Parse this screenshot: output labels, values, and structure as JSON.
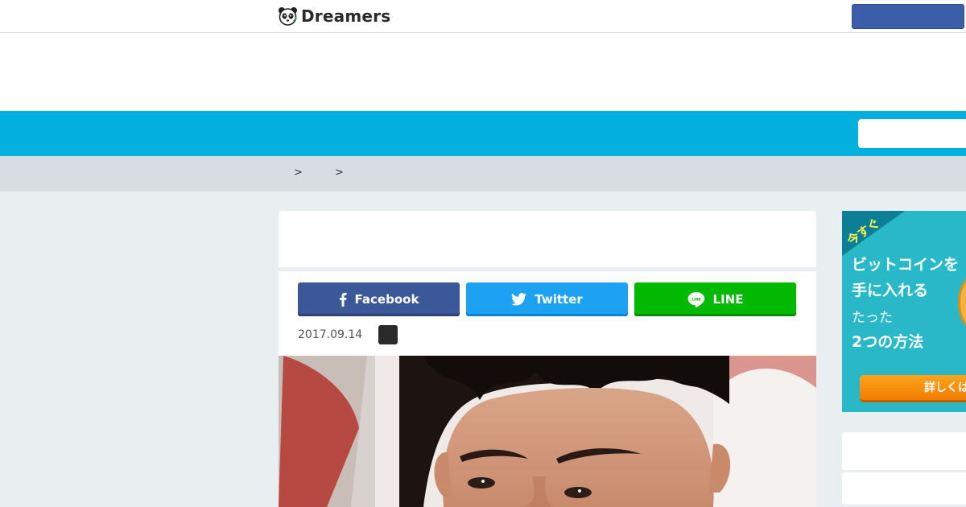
{
  "header": {
    "logo_text": "Dreamers",
    "logo_icon": "panda-icon"
  },
  "breadcrumb": {
    "separators": [
      ">",
      ">"
    ]
  },
  "share": {
    "facebook_label": "Facebook",
    "twitter_label": "Twitter",
    "line_label": "LINE",
    "line_icon_text": "LINE"
  },
  "article": {
    "date": "2017.09.14"
  },
  "sidebar_ad": {
    "corner_label": "今すぐ",
    "line1": "ビットコインを",
    "line2": "手に入れる",
    "line3": "たった",
    "line4": "2つの方法",
    "button_label": "詳しくは"
  },
  "colors": {
    "nav_blue": "#04b1de",
    "facebook": "#3b5998",
    "twitter": "#1da1f2",
    "line": "#00b900",
    "ad_teal": "#29b8c8",
    "ad_button": "#f07d00"
  }
}
